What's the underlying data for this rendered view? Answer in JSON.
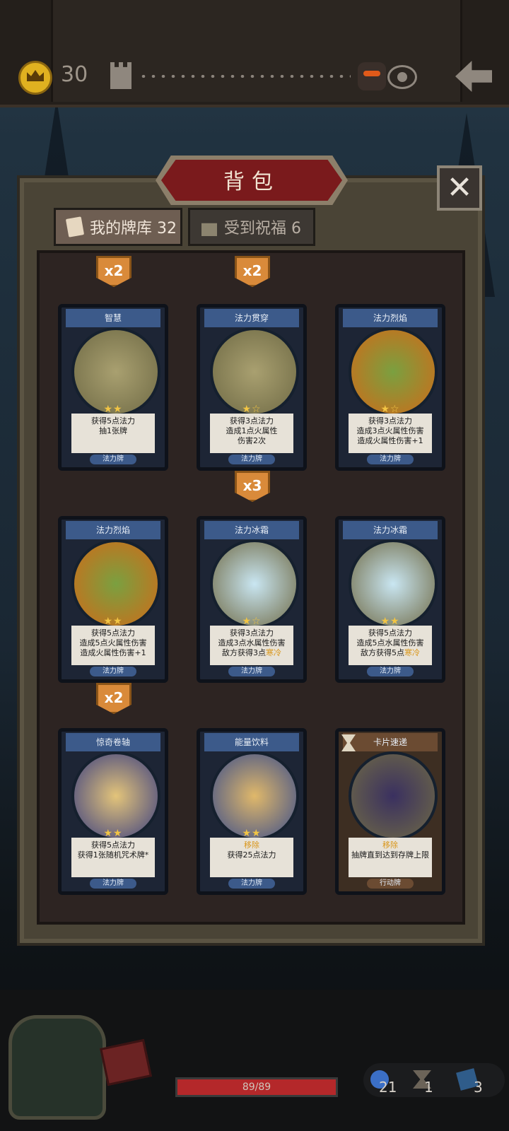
{
  "topbar": {
    "gold": "30"
  },
  "panel": {
    "title": "背包",
    "close_glyph": "✕"
  },
  "tabs": [
    {
      "label": "我的牌库 32",
      "active": true
    },
    {
      "label": "受到祝福 6",
      "active": false
    }
  ],
  "badges": [
    "x2",
    "x2",
    "x3",
    "x2"
  ],
  "cards": [
    {
      "name": "智慧",
      "stars": "★★",
      "desc1": "获得5点法力",
      "desc2": "抽1张牌",
      "desc3": "",
      "type": "法力牌"
    },
    {
      "name": "法力贯穿",
      "stars": "★☆",
      "desc1": "获得3点法力",
      "desc2": "造成1点火属性",
      "desc3": "伤害2次",
      "type": "法力牌"
    },
    {
      "name": "法力烈焰",
      "stars": "★☆",
      "desc1": "获得3点法力",
      "desc2": "造成3点火属性伤害",
      "desc3": "造成火属性伤害+1",
      "type": "法力牌"
    },
    {
      "name": "法力烈焰",
      "stars": "★★",
      "desc1": "获得5点法力",
      "desc2": "造成5点火属性伤害",
      "desc3": "造成火属性伤害+1",
      "type": "法力牌"
    },
    {
      "name": "法力冰霜",
      "stars": "★☆",
      "desc1": "获得3点法力",
      "desc2": "造成3点水属性伤害",
      "desc3_prefix": "敌方获得3点",
      "desc3_hl": "寒冷",
      "type": "法力牌"
    },
    {
      "name": "法力冰霜",
      "stars": "★★",
      "desc1": "获得5点法力",
      "desc2": "造成5点水属性伤害",
      "desc3_prefix": "敌方获得5点",
      "desc3_hl": "寒冷",
      "type": "法力牌"
    },
    {
      "name": "惊奇卷轴",
      "stars": "★★",
      "desc1": "获得5点法力",
      "desc2": "获得1张随机咒术牌*",
      "desc3": "",
      "type": "法力牌"
    },
    {
      "name": "能量饮料",
      "stars": "★★",
      "desc1_hl": "移除",
      "desc2": "获得25点法力",
      "desc3": "",
      "type": "法力牌"
    },
    {
      "name": "卡片速递",
      "stars": "",
      "desc1_hl": "移除",
      "desc2": "抽牌直到达到存牌上限",
      "desc3": "",
      "type": "行动牌"
    }
  ],
  "player": {
    "hp": "89/89",
    "stat1": "21",
    "stat2": "1",
    "stat3": "3"
  },
  "colors": {
    "accent_red": "#7a1a1c",
    "badge": "#d98a3a",
    "card_blue": "#3c5a8a",
    "highlight": "#d9961a"
  }
}
